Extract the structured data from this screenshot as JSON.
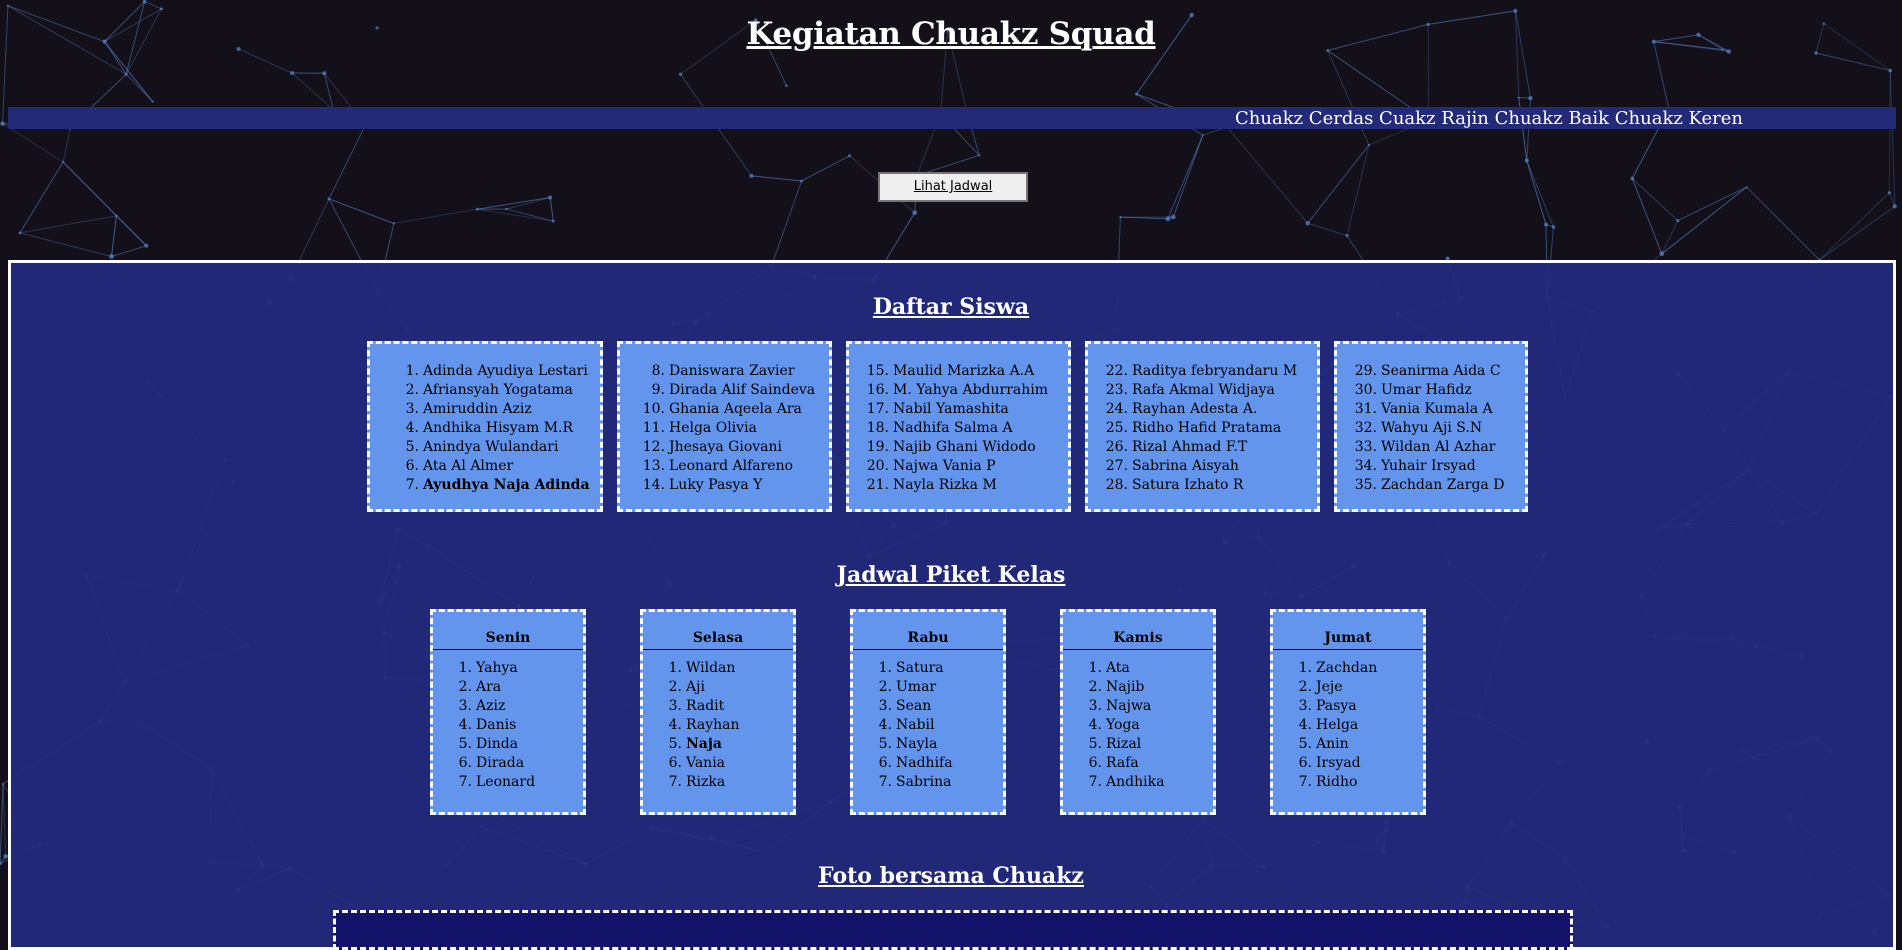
{
  "header": {
    "title": "Kegiatan Chuakz Squad"
  },
  "marquee": {
    "text": "Chuakz Cerdas Cuakz Rajin Chuakz Baik Chuakz Keren"
  },
  "schedule_button": {
    "label": "Lihat Jadwal"
  },
  "students": {
    "heading": "Daftar Siswa",
    "columns": [
      [
        {
          "n": "1.",
          "name": "Adinda Ayudiya Lestari"
        },
        {
          "n": "2.",
          "name": "Afriansyah Yogatama"
        },
        {
          "n": "3.",
          "name": "Amiruddin Aziz"
        },
        {
          "n": "4.",
          "name": "Andhika Hisyam M.R"
        },
        {
          "n": "5.",
          "name": "Anindya Wulandari"
        },
        {
          "n": "6.",
          "name": "Ata Al Almer"
        },
        {
          "n": "7.",
          "name": "Ayudhya Naja Adinda",
          "bold": true
        }
      ],
      [
        {
          "n": "8.",
          "name": "Daniswara Zavier"
        },
        {
          "n": "9.",
          "name": "Dirada Alif Saindeva"
        },
        {
          "n": "10.",
          "name": "Ghania Aqeela Ara"
        },
        {
          "n": "11.",
          "name": "Helga Olivia"
        },
        {
          "n": "12.",
          "name": "Jhesaya Giovani"
        },
        {
          "n": "13.",
          "name": "Leonard Alfareno"
        },
        {
          "n": "14.",
          "name": "Luky Pasya Y"
        }
      ],
      [
        {
          "n": "15.",
          "name": "Maulid Marizka A.A"
        },
        {
          "n": "16.",
          "name": "M. Yahya Abdurrahim"
        },
        {
          "n": "17.",
          "name": "Nabil Yamashita"
        },
        {
          "n": "18.",
          "name": "Nadhifa Salma A"
        },
        {
          "n": "19.",
          "name": "Najib Ghani Widodo"
        },
        {
          "n": "20.",
          "name": "Najwa Vania P"
        },
        {
          "n": "21.",
          "name": "Nayla Rizka M"
        }
      ],
      [
        {
          "n": "22.",
          "name": "Raditya febryandaru M"
        },
        {
          "n": "23.",
          "name": "Rafa Akmal Widjaya"
        },
        {
          "n": "24.",
          "name": "Rayhan Adesta A."
        },
        {
          "n": "25.",
          "name": "Ridho Hafid Pratama"
        },
        {
          "n": "26.",
          "name": "Rizal Ahmad F.T"
        },
        {
          "n": "27.",
          "name": "Sabrina Aisyah"
        },
        {
          "n": "28.",
          "name": "Satura Izhato R"
        }
      ],
      [
        {
          "n": "29.",
          "name": "Seanirma Aida C"
        },
        {
          "n": "30.",
          "name": "Umar Hafidz"
        },
        {
          "n": "31.",
          "name": "Vania Kumala A"
        },
        {
          "n": "32.",
          "name": "Wahyu Aji S.N"
        },
        {
          "n": "33.",
          "name": "Wildan Al Azhar"
        },
        {
          "n": "34.",
          "name": "Yuhair Irsyad"
        },
        {
          "n": "35.",
          "name": "Zachdan Zarga D"
        }
      ]
    ]
  },
  "picket": {
    "heading": "Jadwal Piket Kelas",
    "days": [
      {
        "day": "Senin",
        "members": [
          {
            "name": "Yahya"
          },
          {
            "name": "Ara"
          },
          {
            "name": "Aziz"
          },
          {
            "name": "Danis"
          },
          {
            "name": "Dinda"
          },
          {
            "name": "Dirada"
          },
          {
            "name": "Leonard"
          }
        ]
      },
      {
        "day": "Selasa",
        "members": [
          {
            "name": "Wildan"
          },
          {
            "name": "Aji"
          },
          {
            "name": "Radit"
          },
          {
            "name": "Rayhan"
          },
          {
            "name": "Naja",
            "bold": true
          },
          {
            "name": "Vania"
          },
          {
            "name": "Rizka"
          }
        ]
      },
      {
        "day": "Rabu",
        "members": [
          {
            "name": "Satura"
          },
          {
            "name": "Umar"
          },
          {
            "name": "Sean"
          },
          {
            "name": "Nabil"
          },
          {
            "name": "Nayla"
          },
          {
            "name": "Nadhifa"
          },
          {
            "name": "Sabrina"
          }
        ]
      },
      {
        "day": "Kamis",
        "members": [
          {
            "name": "Ata"
          },
          {
            "name": "Najib"
          },
          {
            "name": "Najwa"
          },
          {
            "name": "Yoga"
          },
          {
            "name": "Rizal"
          },
          {
            "name": "Rafa"
          },
          {
            "name": "Andhika"
          }
        ]
      },
      {
        "day": "Jumat",
        "members": [
          {
            "name": "Zachdan"
          },
          {
            "name": "Jeje"
          },
          {
            "name": "Pasya"
          },
          {
            "name": "Helga"
          },
          {
            "name": "Anin"
          },
          {
            "name": "Irsyad"
          },
          {
            "name": "Ridho"
          }
        ]
      }
    ]
  },
  "photo": {
    "heading": "Foto bersama Chuakz"
  },
  "colors": {
    "page_background": "#131019",
    "panel_background": "#232a80",
    "card_background": "#6495ed",
    "marquee_background": "#232a77",
    "network_lines": "#5b86c9"
  }
}
